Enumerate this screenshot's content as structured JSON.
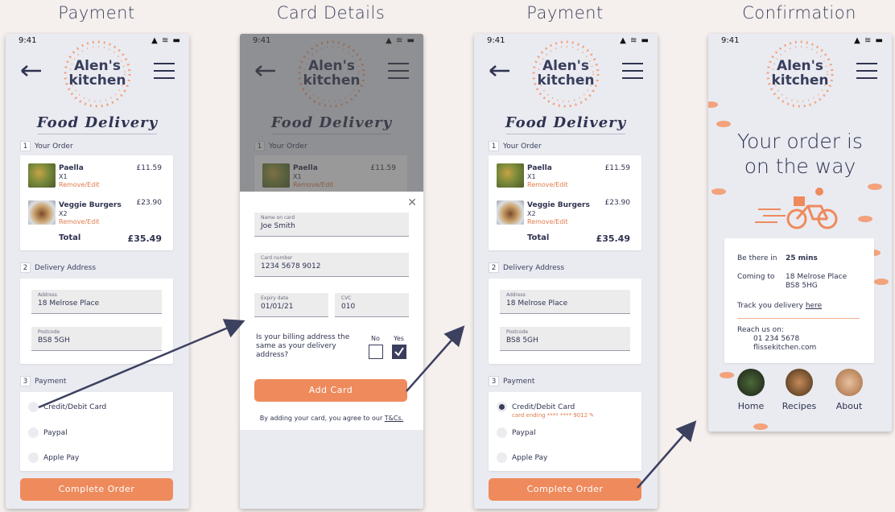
{
  "screens": [
    {
      "title": "Payment"
    },
    {
      "title": "Card Details"
    },
    {
      "title": "Payment"
    },
    {
      "title": "Confirmation"
    }
  ],
  "status": {
    "time": "9:41",
    "icons": "▲ ≋ ▬"
  },
  "brand": {
    "line1": "Alen's",
    "line2": "kitchen",
    "tagline": "Food Delivery"
  },
  "order": {
    "section_num": "1",
    "section_label": "Your Order",
    "items": [
      {
        "name": "Paella",
        "qty": "X1",
        "edit": "Remove/Edit",
        "price": "£11.59"
      },
      {
        "name": "Veggie Burgers",
        "qty": "X2",
        "edit": "Remove/Edit",
        "price": "£23.90"
      }
    ],
    "total_label": "Total",
    "total_value": "£35.49"
  },
  "address": {
    "section_num": "2",
    "section_label": "Delivery Address",
    "address_label": "Address",
    "address_value": "18 Melrose Place",
    "postcode_label": "Postcode",
    "postcode_value": "BS8 5GH"
  },
  "payment": {
    "section_num": "3",
    "section_label": "Payment",
    "options": [
      "Credit/Debit Card",
      "Paypal",
      "Apple Pay"
    ],
    "card_ending": "card ending **** **** 9012",
    "cta": "Complete Order"
  },
  "card_modal": {
    "close": "✕",
    "name_label": "Name on card",
    "name_value": "Joe Smith",
    "number_label": "Card number",
    "number_value": "1234 5678 9012",
    "expiry_label": "Expiry date",
    "expiry_value": "01/01/21",
    "cvc_label": "CVC",
    "cvc_value": "010",
    "billing_question": "Is your billing address the same as your delivery address?",
    "no_label": "No",
    "yes_label": "Yes",
    "cta": "Add Card",
    "agree_prefix": "By adding your card, you agree to our",
    "agree_link": "T&Cs."
  },
  "confirmation": {
    "heading_line1": "Your order is",
    "heading_line2": "on the way",
    "be_there_label": "Be there in",
    "be_there_value": "25 mins",
    "coming_to_label": "Coming to",
    "coming_to_line1": "18 Melrose Place",
    "coming_to_line2": "BS8 5HG",
    "track_prefix": "Track you delivery",
    "track_link": "here",
    "reach_label": "Reach us on:",
    "phone": "01 234 5678",
    "email": "flissekitchen.com",
    "nav": [
      "Home",
      "Recipes",
      "About"
    ]
  },
  "colors": {
    "accent": "#ef8a5c",
    "navy": "#2f3350",
    "bg": "#e9ebf1"
  }
}
